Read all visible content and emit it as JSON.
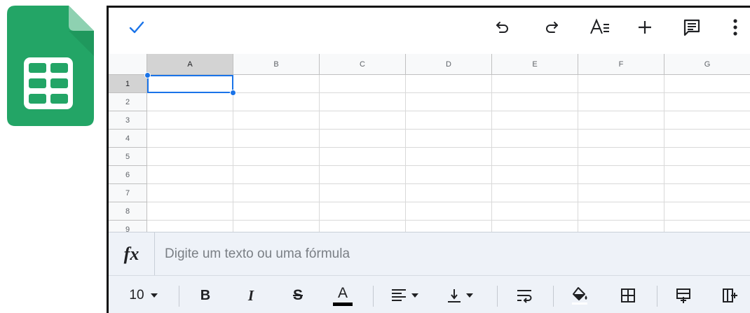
{
  "app": {
    "name": "Google Sheets",
    "brand_color": "#0f9d58",
    "accent_color": "#1a73e8"
  },
  "top_toolbar": {
    "icons": [
      "check-icon",
      "undo-icon",
      "redo-icon",
      "text-format-icon",
      "insert-icon",
      "comment-icon",
      "more-vert-icon"
    ]
  },
  "sheet": {
    "columns": [
      "A",
      "B",
      "C",
      "D",
      "E",
      "F",
      "G"
    ],
    "rows": [
      "1",
      "2",
      "3",
      "4",
      "5",
      "6",
      "7",
      "8",
      "9"
    ],
    "selected_cell": "A1"
  },
  "formula_bar": {
    "label": "fx",
    "placeholder": "Digite um texto ou uma fórmula"
  },
  "bottom_toolbar": {
    "font_size": "10",
    "bold_label": "B",
    "italic_label": "I",
    "strike_label": "S",
    "text_color_label": "A",
    "icons": [
      "font-size-dropdown-icon",
      "bold-icon",
      "italic-icon",
      "strikethrough-icon",
      "text-color-icon",
      "horizontal-align-icon",
      "vertical-align-icon",
      "text-wrap-icon",
      "fill-color-icon",
      "borders-icon",
      "insert-row-icon",
      "insert-column-icon"
    ]
  }
}
